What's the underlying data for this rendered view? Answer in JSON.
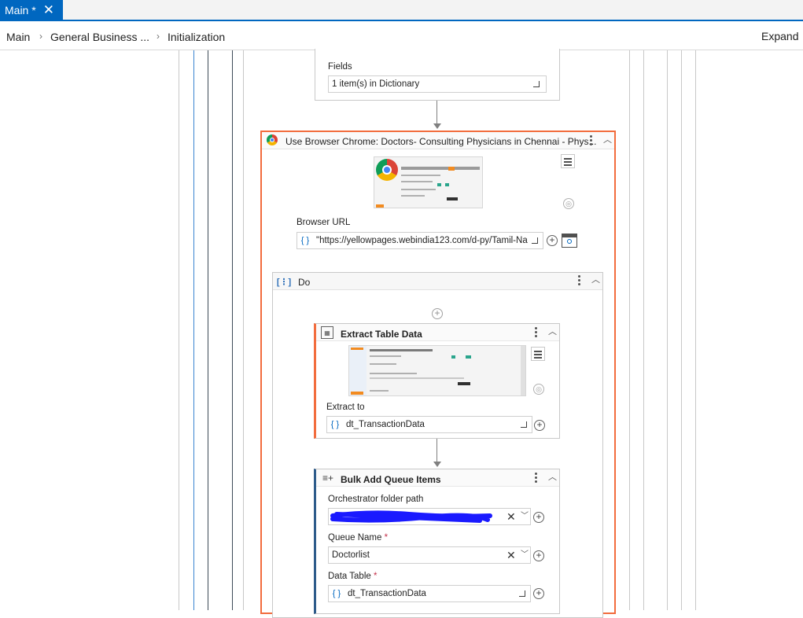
{
  "tabs": [
    {
      "label": "Main *"
    }
  ],
  "breadcrumb": {
    "items": [
      "Main",
      "General Business ...",
      "Initialization"
    ],
    "expand_label": "Expand"
  },
  "fields_card": {
    "label": "Fields",
    "value": "1 item(s) in Dictionary"
  },
  "use_browser": {
    "title": "Use Browser Chrome: Doctors- Consulting Physicians in Chennai - Phys...",
    "url_label": "Browser URL",
    "url_value": "\"https://yellowpages.webindia123.com/d-py/Tamil-Na"
  },
  "do_container": {
    "title": "Do"
  },
  "extract_table": {
    "title": "Extract Table Data",
    "extract_to_label": "Extract to",
    "extract_to_value": "dt_TransactionData"
  },
  "bulk_add": {
    "title": "Bulk Add Queue Items",
    "folder_label": "Orchestrator folder path",
    "queue_name_label": "Queue Name",
    "queue_name_value": "Doctorlist",
    "data_table_label": "Data Table",
    "data_table_value": "dt_TransactionData",
    "required_mark": "*"
  },
  "colors": {
    "accent": "#0067c0",
    "selected_border": "#f26c3d",
    "redaction": "#1a1aff"
  }
}
